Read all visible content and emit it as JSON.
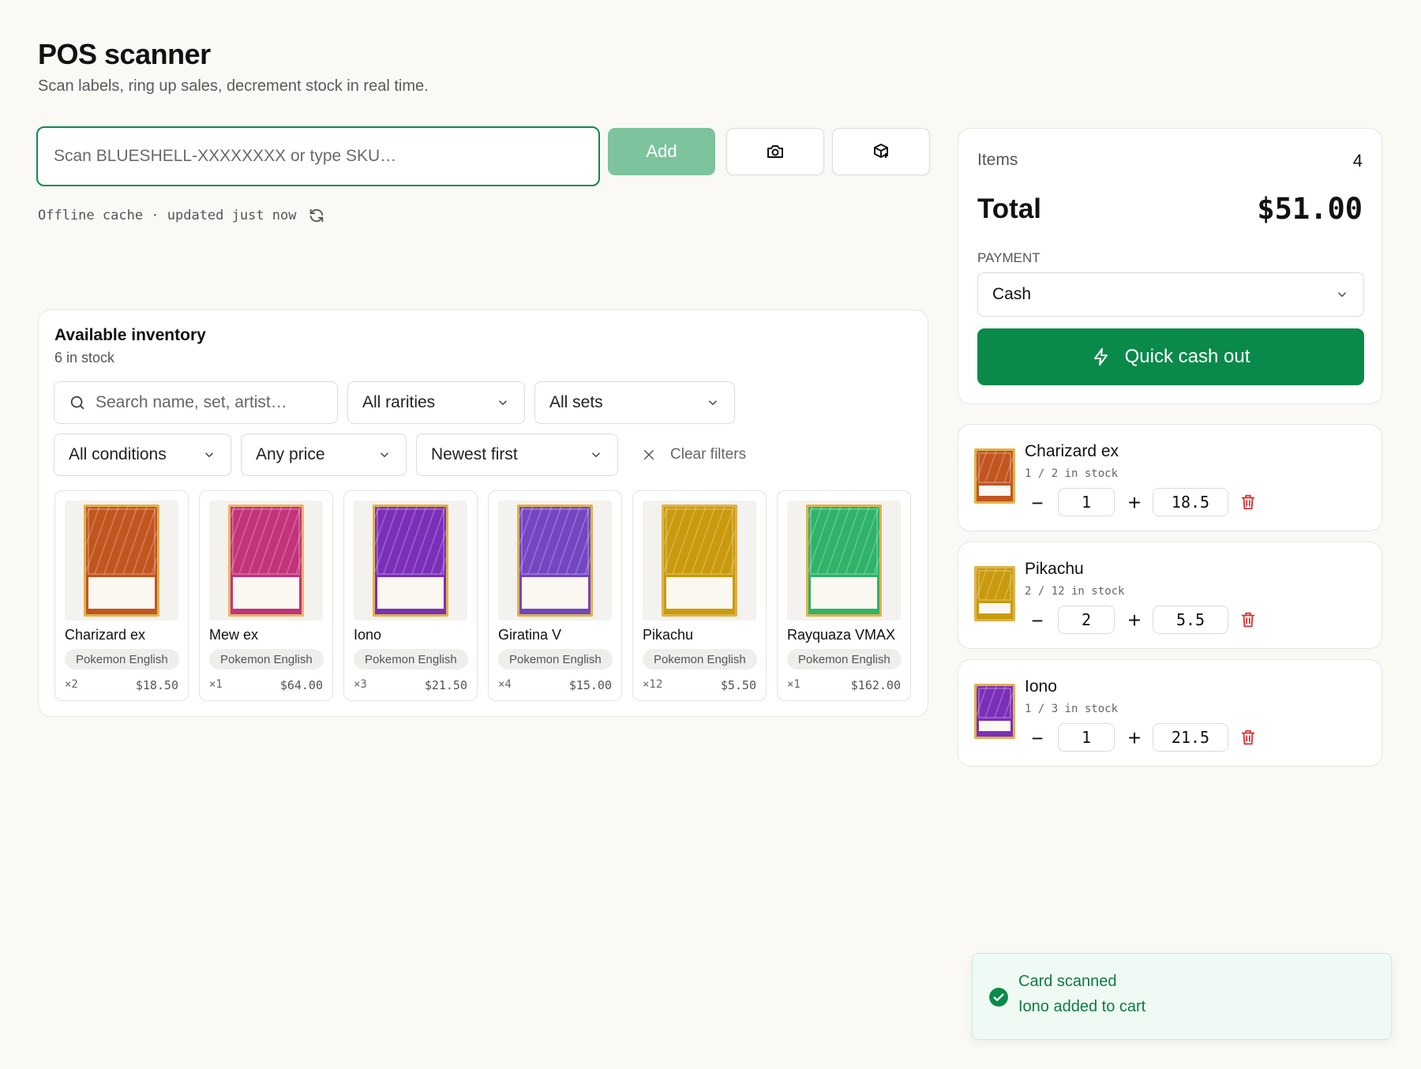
{
  "header": {
    "title": "POS scanner",
    "subtitle": "Scan labels, ring up sales, decrement stock in real time."
  },
  "scanner": {
    "placeholder": "Scan BLUESHELL-XXXXXXXX or type SKU…",
    "add_label": "Add",
    "camera_icon": "camera-icon",
    "package_icon": "package-plus-icon",
    "cache_text": "Offline cache · updated just now",
    "refresh_icon": "refresh-icon"
  },
  "inventory": {
    "title": "Available inventory",
    "count": "6 in stock",
    "search_placeholder": "Search name, set, artist…",
    "filters": {
      "rarity": "All rarities",
      "sets": "All sets",
      "conditions": "All conditions",
      "price": "Any price",
      "sort": "Newest first"
    },
    "clear_label": "Clear filters",
    "cards": [
      {
        "name": "Charizard ex",
        "tag": "Pokemon English",
        "qty": "×2",
        "price": "$18.50",
        "color": "#c2551f",
        "frame": "#e0b24a"
      },
      {
        "name": "Mew ex",
        "tag": "Pokemon English",
        "qty": "×1",
        "price": "$64.00",
        "color": "#c2337a",
        "frame": "#e8b66a"
      },
      {
        "name": "Iono",
        "tag": "Pokemon English",
        "qty": "×3",
        "price": "$21.50",
        "color": "#7b2fb8",
        "frame": "#e0b24a"
      },
      {
        "name": "Giratina V",
        "tag": "Pokemon English",
        "qty": "×4",
        "price": "$15.00",
        "color": "#7346c2",
        "frame": "#e0b24a"
      },
      {
        "name": "Pikachu",
        "tag": "Pokemon English",
        "qty": "×12",
        "price": "$5.50",
        "color": "#c99a0c",
        "frame": "#e0b24a"
      },
      {
        "name": "Rayquaza VMAX",
        "tag": "Pokemon English",
        "qty": "×1",
        "price": "$162.00",
        "color": "#2fb36a",
        "frame": "#e0b24a"
      }
    ]
  },
  "summary": {
    "items_label": "Items",
    "items_value": "4",
    "total_label": "Total",
    "total_value": "$51.00",
    "payment_label": "PAYMENT",
    "payment_value": "Cash",
    "cashout_label": "Quick cash out"
  },
  "cart": [
    {
      "name": "Charizard ex",
      "stock": "1 / 2 in stock",
      "qty": "1",
      "price": "18.5",
      "color": "#c2551f"
    },
    {
      "name": "Pikachu",
      "stock": "2 / 12 in stock",
      "qty": "2",
      "price": "5.5",
      "color": "#c99a0c"
    },
    {
      "name": "Iono",
      "stock": "1 / 3 in stock",
      "qty": "1",
      "price": "21.5",
      "color": "#7b2fb8"
    }
  ],
  "toast": {
    "title": "Card scanned",
    "message": "Iono added to cart"
  },
  "colors": {
    "brand": "#0a8a4a",
    "add_disabled": "#7dc39e",
    "delete": "#d93030"
  }
}
